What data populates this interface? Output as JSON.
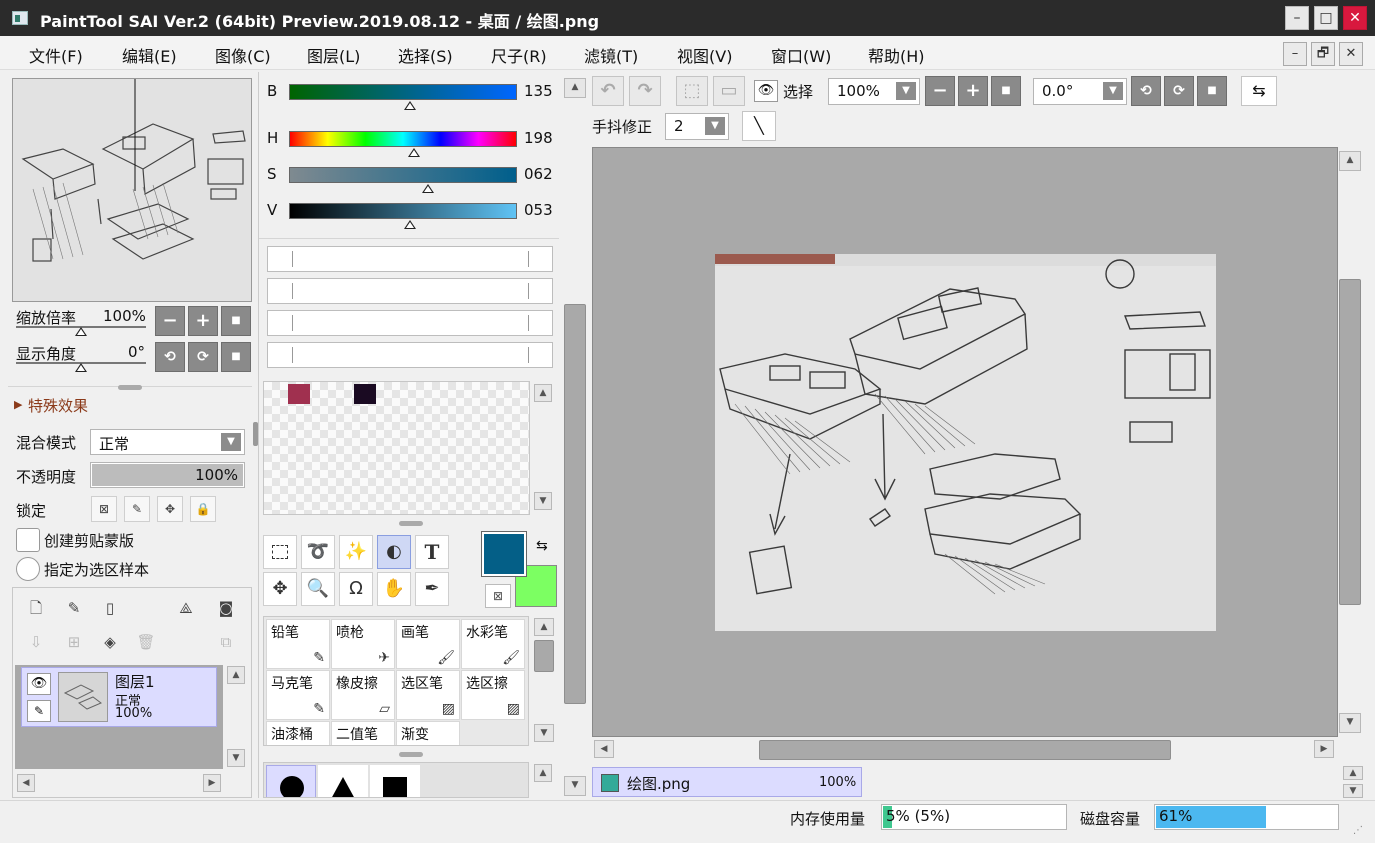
{
  "window": {
    "title": "PaintTool SAI Ver.2 (64bit) Preview.2019.08.12 - 桌面 / 绘图.png",
    "minimize": "–",
    "maximize": "□",
    "close": "✕"
  },
  "menu": {
    "items": [
      "文件(F)",
      "编辑(E)",
      "图像(C)",
      "图层(L)",
      "选择(S)",
      "尺子(R)",
      "滤镜(T)",
      "视图(V)",
      "窗口(W)",
      "帮助(H)"
    ],
    "mdi_min": "–",
    "mdi_restore": "🗗",
    "mdi_close": "✕"
  },
  "navigator": {
    "zoom_label": "缩放倍率",
    "zoom_value": "100%",
    "angle_label": "显示角度",
    "angle_value": "0°"
  },
  "layer_props": {
    "effects_label": "特殊效果",
    "blend_label": "混合模式",
    "blend_value": "正常",
    "opacity_label": "不透明度",
    "opacity_value": "100%",
    "opacity_level": 1.0,
    "lock_label": "锁定",
    "clip_label": "创建剪贴蒙版",
    "sample_label": "指定为选区样本"
  },
  "layers": [
    {
      "name": "图层1",
      "mode": "正常",
      "opacity": "100%"
    }
  ],
  "color": {
    "sliders": [
      {
        "label": "B",
        "value": "135",
        "level": 0.53,
        "gradient": "linear-gradient(to right, #006400, #0066ff)"
      },
      {
        "label": "H",
        "value": "198",
        "level": 0.55,
        "gradient": "linear-gradient(to right, #ff0000, #ffff00, #00ff00, #00ffff, #0000ff, #ff00ff, #ff0000)"
      },
      {
        "label": "S",
        "value": "062",
        "level": 0.61,
        "gradient": "linear-gradient(to right, #7f8a90, #005f8c)"
      },
      {
        "label": "V",
        "value": "053",
        "level": 0.53,
        "gradient": "linear-gradient(to right, #000000, #5fc3f5)"
      }
    ],
    "swatches": [
      "#a0304f",
      "#1a0a22"
    ],
    "primary": "#045f87",
    "secondary": "#7cff62"
  },
  "tools": [
    "selection-rect",
    "lasso",
    "magic-wand",
    "selection-pen",
    "text",
    "move",
    "zoom",
    "rotate",
    "hand",
    "eyedropper"
  ],
  "brushes": [
    {
      "name": "铅笔",
      "icon": "✎"
    },
    {
      "name": "喷枪",
      "icon": "✈"
    },
    {
      "name": "画笔",
      "icon": "🖌"
    },
    {
      "name": "水彩笔",
      "icon": "🖌"
    },
    {
      "name": "马克笔",
      "icon": "✎"
    },
    {
      "name": "橡皮擦",
      "icon": "▱"
    },
    {
      "name": "选区笔",
      "icon": "▨"
    },
    {
      "name": "选区擦",
      "icon": "▨"
    },
    {
      "name": "油漆桶",
      "icon": ""
    },
    {
      "name": "二值笔",
      "icon": ""
    },
    {
      "name": "渐变",
      "icon": ""
    }
  ],
  "toolbar": {
    "select_label": "选择",
    "zoom_value": "100%",
    "angle_value": "0.0°",
    "stabilizer_label": "手抖修正",
    "stabilizer_value": "2"
  },
  "document_tab": {
    "name": "绘图.png",
    "zoom": "100%"
  },
  "status": {
    "memory_label": "内存使用量",
    "memory_value": "5% (5%)",
    "memory_level": 0.05,
    "disk_label": "磁盘容量",
    "disk_value": "61%",
    "disk_level": 0.61
  }
}
